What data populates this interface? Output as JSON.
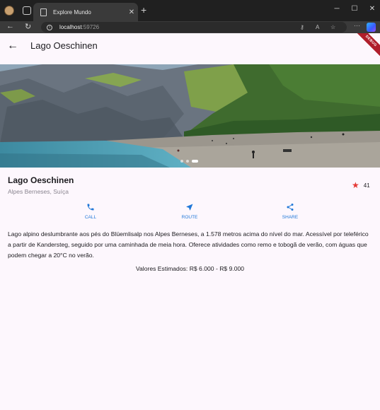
{
  "browser": {
    "tab_title": "Explore Mundo",
    "tab_close": "✕",
    "new_tab": "+",
    "url_host": "localhost",
    "url_port": ":59726",
    "more": "···"
  },
  "appbar": {
    "title": "Lago Oeschinen",
    "debug_banner": "DEBUG"
  },
  "carousel": {
    "page_count": 3,
    "active_index": 2
  },
  "place": {
    "name": "Lago Oeschinen",
    "region": "Alpes Berneses, Suíça",
    "rating": "41"
  },
  "actions": {
    "call": "CALL",
    "route": "ROUTE",
    "share": "SHARE"
  },
  "description": "Lago alpino deslumbrante aos pés do Blüemlisalp nos Alpes Berneses, a 1.578 metros acima do nível do mar. Acessível por teleférico a partir de Kandersteg, seguido por uma caminhada de meia hora. Oferece atividades como remo e tobogã de verão, com águas que podem chegar a 20°C no verão.",
  "estimate": "Valores Estimados: R$ 6.000 - R$ 9.000",
  "colors": {
    "accent": "#1e77d8",
    "star": "#e53935",
    "background": "#fdf7fd"
  }
}
